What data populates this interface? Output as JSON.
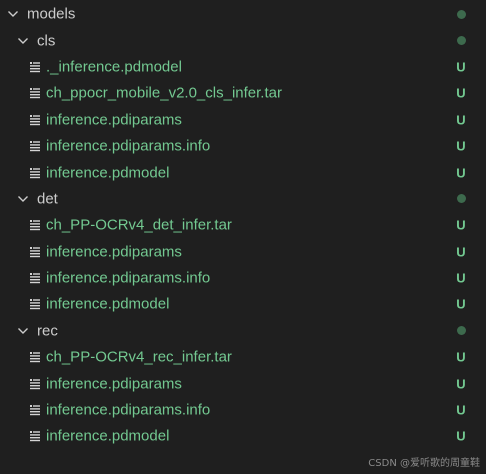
{
  "explorer": {
    "root": {
      "label": "models",
      "status": "dot"
    },
    "folders": [
      {
        "label": "cls",
        "status": "dot",
        "files": [
          {
            "label": "._inference.pdmodel",
            "status": "U"
          },
          {
            "label": "ch_ppocr_mobile_v2.0_cls_infer.tar",
            "status": "U"
          },
          {
            "label": "inference.pdiparams",
            "status": "U"
          },
          {
            "label": "inference.pdiparams.info",
            "status": "U"
          },
          {
            "label": "inference.pdmodel",
            "status": "U"
          }
        ]
      },
      {
        "label": "det",
        "status": "dot",
        "files": [
          {
            "label": "ch_PP-OCRv4_det_infer.tar",
            "status": "U"
          },
          {
            "label": "inference.pdiparams",
            "status": "U"
          },
          {
            "label": "inference.pdiparams.info",
            "status": "U"
          },
          {
            "label": "inference.pdmodel",
            "status": "U"
          }
        ]
      },
      {
        "label": "rec",
        "status": "dot",
        "files": [
          {
            "label": "ch_PP-OCRv4_rec_infer.tar",
            "status": "U"
          },
          {
            "label": "inference.pdiparams",
            "status": "U"
          },
          {
            "label": "inference.pdiparams.info",
            "status": "U"
          },
          {
            "label": "inference.pdmodel",
            "status": "U"
          }
        ]
      }
    ]
  },
  "watermark": "CSDN @爱听歌的周童鞋",
  "colors": {
    "background": "#1f1f1f",
    "folder_text": "#cccccc",
    "untracked_text": "#73c991",
    "folder_dot": "#3d6a4d",
    "icon": "#d4d4d4"
  },
  "icons": {
    "expanded": "chevron-down-icon",
    "file": "file-lines-icon"
  }
}
